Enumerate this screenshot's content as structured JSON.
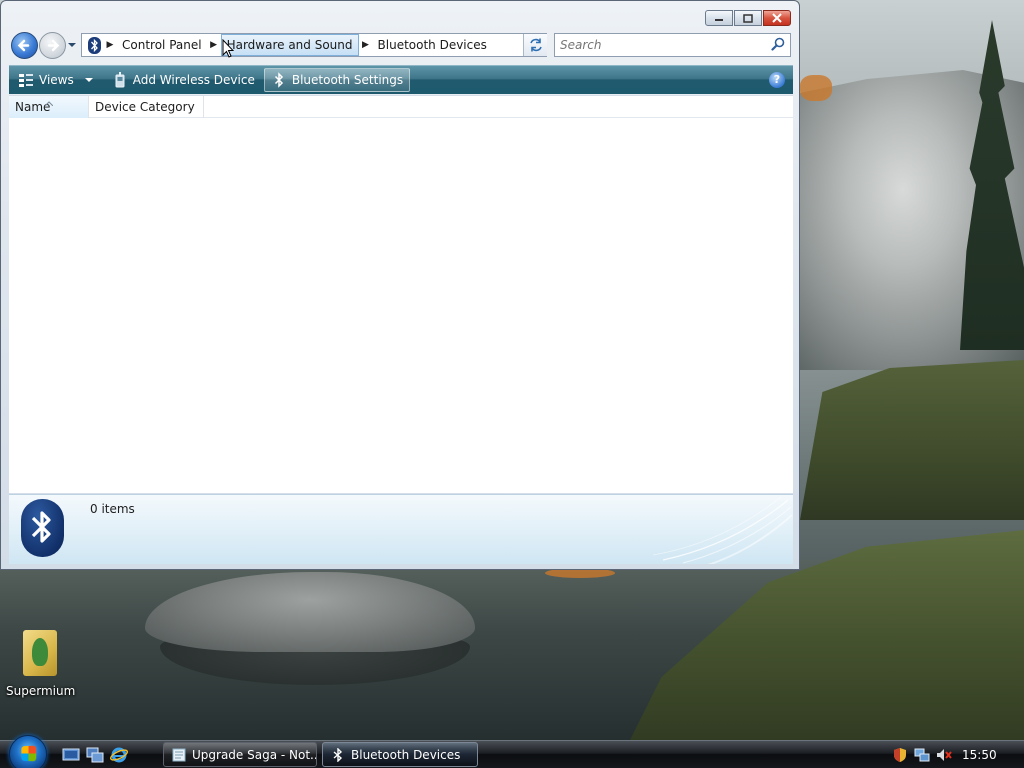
{
  "desktop": {
    "icons": [
      {
        "label": "Supermium"
      }
    ]
  },
  "window": {
    "caption_buttons": {
      "minimize": "▭",
      "maximize": "❐",
      "close": "✕"
    },
    "breadcrumb": [
      "Control Panel",
      "Hardware and Sound",
      "Bluetooth Devices"
    ],
    "search": {
      "placeholder": "Search",
      "value": ""
    },
    "toolbar": {
      "views_label": "Views",
      "add_device_label": "Add Wireless Device",
      "settings_label": "Bluetooth Settings",
      "help_label": "?"
    },
    "columns": [
      "Name",
      "Device Category"
    ],
    "items": [],
    "details": {
      "status": "0 items"
    }
  },
  "taskbar": {
    "tasks": [
      {
        "label": "Upgrade Saga - Not...",
        "active": false
      },
      {
        "label": "Bluetooth Devices",
        "active": true
      }
    ],
    "clock": "15:50"
  },
  "icons": {
    "back": "arrow-left-icon",
    "forward": "arrow-right-icon",
    "refresh": "refresh-icon",
    "search": "magnifier-icon",
    "views": "views-icon",
    "add_device": "add-device-icon",
    "bluetooth": "bluetooth-icon",
    "help": "help-icon"
  },
  "colors": {
    "toolbar": "#215a6e",
    "bluetooth_blue": "#12316b",
    "close_red": "#c43220"
  }
}
